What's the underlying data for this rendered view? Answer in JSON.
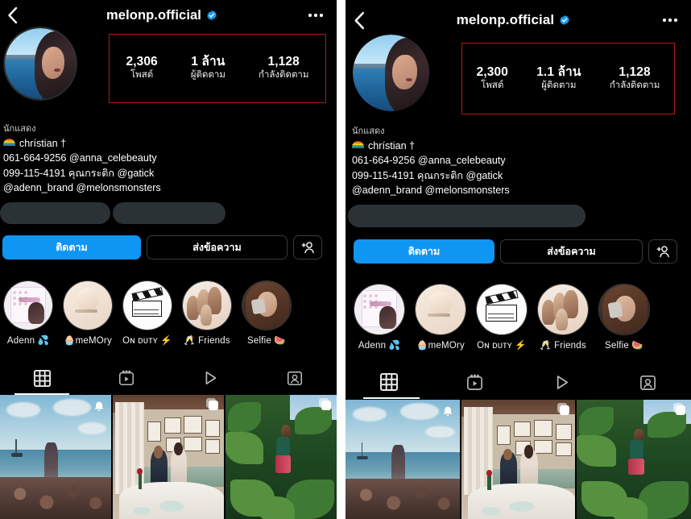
{
  "app": "instagram-profile",
  "colors": {
    "background": "#000000",
    "accent_blue": "#0f95f2",
    "verified_blue": "#1d9bf0",
    "annotation_red": "#b01818",
    "divider": "#ffffff",
    "redaction_gray": "#2b3236"
  },
  "panels": [
    {
      "id": "left",
      "header": {
        "back_icon": "chevron-left-icon",
        "username": "melonp.official",
        "verified_icon": "verified-badge-icon",
        "verified": true,
        "menu_icon": "more-options-icon"
      },
      "stats": {
        "highlighted": true,
        "items": [
          {
            "value": "2,306",
            "label": "โพสต์"
          },
          {
            "value": "1 ล้าน",
            "label": "ผู้ติดตาม"
          },
          {
            "value": "1,128",
            "label": "กำลังติดตาม"
          }
        ]
      },
      "bio": {
        "category": "นักแสดง",
        "lines": [
          {
            "text": "chrístian †",
            "icon": "rainbow-emoji"
          },
          {
            "text": "061-664-9256 @anna_celebeauty"
          },
          {
            "text": "099-115-4191 คุณกระติก @gatick"
          },
          {
            "text": "@adenn_brand @melonsmonsters"
          }
        ]
      },
      "redactions": 2,
      "actions": {
        "follow_label": "ติดตาม",
        "message_label": "ส่งข้อความ",
        "add_person_icon": "add-person-icon"
      },
      "highlights": [
        {
          "label": "Adenn 💦",
          "art": "hl1"
        },
        {
          "label": "🧁meMOry",
          "art": "hl2"
        },
        {
          "label": "Oɴ ᴅᴜᴛʏ ⚡",
          "art": "hl3"
        },
        {
          "label": "🥂 Friends",
          "art": "hl4"
        },
        {
          "label": "Selfie 🍉",
          "art": "hl5"
        }
      ],
      "tabs": [
        {
          "icon": "grid-icon",
          "active": true
        },
        {
          "icon": "reels-icon",
          "active": false
        },
        {
          "icon": "video-play-icon",
          "active": false
        },
        {
          "icon": "tagged-person-icon",
          "active": false
        }
      ],
      "grid": [
        {
          "scene": "beach-silhouette",
          "badge": "bell-icon"
        },
        {
          "scene": "restaurant-couple",
          "badge": "multi-photo-icon"
        },
        {
          "scene": "jungle-portrait",
          "badge": "multi-photo-icon"
        }
      ]
    },
    {
      "id": "right",
      "header": {
        "back_icon": "chevron-left-icon",
        "username": "melonp.official",
        "verified_icon": "verified-badge-icon",
        "verified": true,
        "menu_icon": "more-options-icon"
      },
      "stats": {
        "highlighted": true,
        "items": [
          {
            "value": "2,300",
            "label": "โพสต์"
          },
          {
            "value": "1.1 ล้าน",
            "label": "ผู้ติดตาม"
          },
          {
            "value": "1,128",
            "label": "กำลังติดตาม"
          }
        ]
      },
      "bio": {
        "category": "นักแสดง",
        "lines": [
          {
            "text": "chrístian †",
            "icon": "rainbow-emoji"
          },
          {
            "text": "061-664-9256 @anna_celebeauty"
          },
          {
            "text": "099-115-4191 คุณกระติก @gatick"
          },
          {
            "text": "@adenn_brand @melonsmonsters"
          }
        ]
      },
      "redactions": 1,
      "actions": {
        "follow_label": "ติดตาม",
        "message_label": "ส่งข้อความ",
        "add_person_icon": "add-person-icon"
      },
      "highlights": [
        {
          "label": "Adenn 💦",
          "art": "hl1"
        },
        {
          "label": "🧁meMOry",
          "art": "hl2"
        },
        {
          "label": "Oɴ ᴅᴜᴛʏ ⚡",
          "art": "hl3"
        },
        {
          "label": "🥂 Friends",
          "art": "hl4"
        },
        {
          "label": "Selfie 🍉",
          "art": "hl5"
        }
      ],
      "tabs": [
        {
          "icon": "grid-icon",
          "active": true
        },
        {
          "icon": "reels-icon",
          "active": false
        },
        {
          "icon": "video-play-icon",
          "active": false
        },
        {
          "icon": "tagged-person-icon",
          "active": false
        }
      ],
      "grid": [
        {
          "scene": "beach-silhouette",
          "badge": "bell-icon"
        },
        {
          "scene": "restaurant-couple",
          "badge": "multi-photo-icon"
        },
        {
          "scene": "jungle-portrait",
          "badge": "multi-photo-icon"
        }
      ]
    }
  ]
}
